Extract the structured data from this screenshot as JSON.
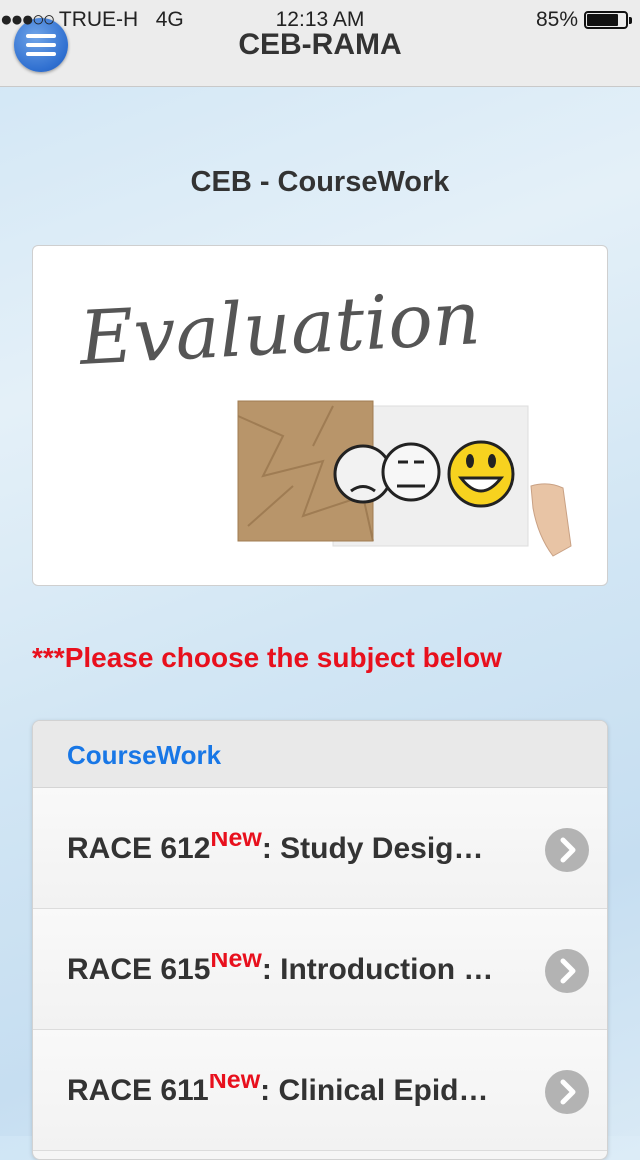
{
  "status_bar": {
    "signal": "●●●○○",
    "carrier": "TRUE-H",
    "network": "4G",
    "time": "12:13 AM",
    "battery_percent": "85%",
    "battery_level": 0.85
  },
  "navbar": {
    "title": "CEB-RAMA",
    "menu_icon": "hamburger-menu-icon",
    "accent_color": "#2f6fd0"
  },
  "page": {
    "heading": "CEB - CourseWork",
    "banner": {
      "image_text": "Evaluation"
    },
    "instruction": "***Please choose the subject below",
    "instruction_color": "#e8101d"
  },
  "list": {
    "header": "CourseWork",
    "header_color": "#1877e6",
    "items": [
      {
        "code": "RACE 612",
        "badge": "New",
        "title": ": Study Desig…"
      },
      {
        "code": "RACE 615",
        "badge": "New",
        "title": ": Introduction …"
      },
      {
        "code": "RACE 611",
        "badge": "New",
        "title": ": Clinical Epid…"
      }
    ],
    "item_icon": "chevron-right-icon"
  }
}
